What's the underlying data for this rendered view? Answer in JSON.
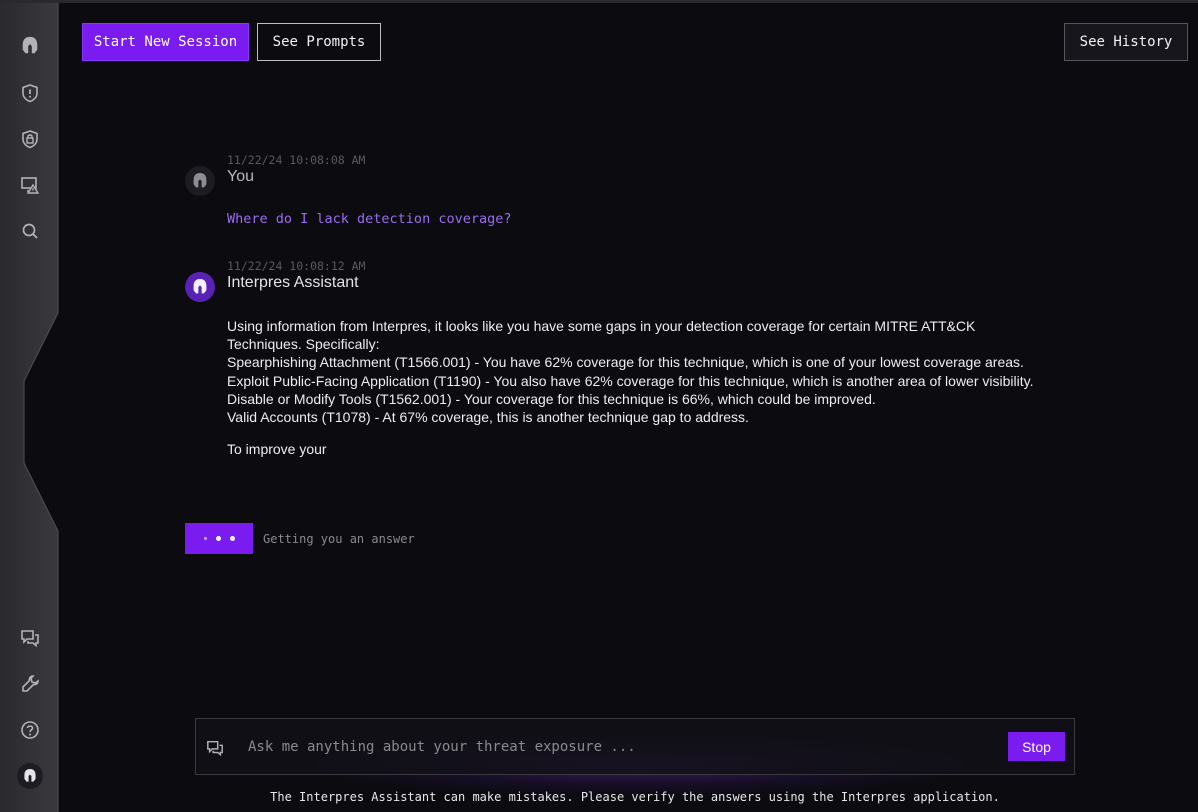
{
  "header": {
    "start_new_session": "Start New Session",
    "see_prompts": "See Prompts",
    "see_history": "See History"
  },
  "sidebar": {
    "icons_top": [
      "logo-helmet-icon",
      "shield-alert-icon",
      "shield-lock-icon",
      "monitor-warning-icon",
      "search-icon"
    ],
    "icons_bottom": [
      "chat-bubbles-icon",
      "wrench-icon",
      "help-circle-icon",
      "user-avatar-icon"
    ]
  },
  "conversation": {
    "user_message": {
      "timestamp": "11/22/24 10:08:08 AM",
      "sender": "You",
      "text": "Where do I lack detection coverage?"
    },
    "assistant_message": {
      "timestamp": "11/22/24 10:08:12 AM",
      "sender": "Interpres Assistant",
      "lines": [
        "Using information from Interpres, it looks like you have some gaps in your detection coverage for certain MITRE ATT&CK Techniques. Specifically:",
        "Spearphishing Attachment (T1566.001) - You have 62% coverage for this technique, which is one of your lowest coverage areas.",
        "Exploit Public-Facing Application (T1190) - You also have 62% coverage for this technique, which is another area of lower visibility.",
        "Disable or Modify Tools (T1562.001) - Your coverage for this technique is 66%, which could be improved.",
        "Valid Accounts (T1078) - At 67% coverage, this is another technique gap to address."
      ],
      "trailing": "To improve your"
    },
    "loading_text": "Getting you an answer"
  },
  "input": {
    "placeholder": "Ask me anything about your threat exposure ...",
    "value": "",
    "stop_label": "Stop"
  },
  "footer": {
    "disclaimer": "The Interpres Assistant can make mistakes. Please verify the answers using the Interpres application."
  },
  "colors": {
    "accent": "#7a1cf0",
    "background": "#0c0b10",
    "question_text": "#9a6cf0"
  }
}
